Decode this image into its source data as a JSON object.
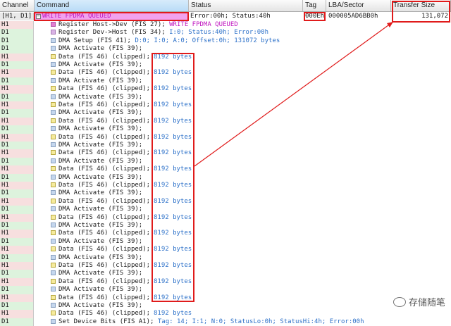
{
  "columns": [
    "Channel",
    "Command",
    "Status",
    "Tag",
    "LBA/Sector",
    "Transfer Size"
  ],
  "first_row": {
    "channel": "[H1, D1]",
    "expander": "⊟",
    "command": "WRITE FPDMA QUEUED",
    "status": "Error:00h; Status:40h",
    "tag": "000Eh",
    "lba": "000005AD6BB0h",
    "size": "131,072"
  },
  "rows": [
    {
      "ch": "H1",
      "icon": "magenta",
      "text": "Register Host->Dev (FIS 27); ",
      "extra": "WRITE FPDMA QUEUED",
      "extra_color": "magenta"
    },
    {
      "ch": "D1",
      "icon": "lilac",
      "text": "Register Dev->Host (FIS 34); ",
      "extra": "I:0; Status:40h; Error:00h",
      "extra_color": "blue"
    },
    {
      "ch": "D1",
      "icon": "blue",
      "text": "DMA Setup (FIS 41); ",
      "extra": "D:0; I:0; A:0; Offset:0h; 131072 bytes",
      "extra_color": "blue"
    },
    {
      "ch": "D1",
      "icon": "blue",
      "text": "DMA Activate (FIS 39);",
      "extra": "",
      "extra_color": "blue"
    },
    {
      "ch": "H1",
      "icon": "yellow",
      "text": "Data (FIS 46) (clipped);",
      "extra": "8192 bytes",
      "extra_color": "blue"
    },
    {
      "ch": "D1",
      "icon": "blue",
      "text": "DMA Activate (FIS 39);",
      "extra": "",
      "extra_color": "blue"
    },
    {
      "ch": "H1",
      "icon": "yellow",
      "text": "Data (FIS 46) (clipped);",
      "extra": "8192 bytes",
      "extra_color": "blue"
    },
    {
      "ch": "D1",
      "icon": "blue",
      "text": "DMA Activate (FIS 39);",
      "extra": "",
      "extra_color": "blue"
    },
    {
      "ch": "H1",
      "icon": "yellow",
      "text": "Data (FIS 46) (clipped);",
      "extra": "8192 bytes",
      "extra_color": "blue"
    },
    {
      "ch": "D1",
      "icon": "blue",
      "text": "DMA Activate (FIS 39);",
      "extra": "",
      "extra_color": "blue"
    },
    {
      "ch": "H1",
      "icon": "yellow",
      "text": "Data (FIS 46) (clipped);",
      "extra": "8192 bytes",
      "extra_color": "blue"
    },
    {
      "ch": "D1",
      "icon": "blue",
      "text": "DMA Activate (FIS 39);",
      "extra": "",
      "extra_color": "blue"
    },
    {
      "ch": "H1",
      "icon": "yellow",
      "text": "Data (FIS 46) (clipped);",
      "extra": "8192 bytes",
      "extra_color": "blue"
    },
    {
      "ch": "D1",
      "icon": "blue",
      "text": "DMA Activate (FIS 39);",
      "extra": "",
      "extra_color": "blue"
    },
    {
      "ch": "H1",
      "icon": "yellow",
      "text": "Data (FIS 46) (clipped);",
      "extra": "8192 bytes",
      "extra_color": "blue"
    },
    {
      "ch": "D1",
      "icon": "blue",
      "text": "DMA Activate (FIS 39);",
      "extra": "",
      "extra_color": "blue"
    },
    {
      "ch": "H1",
      "icon": "yellow",
      "text": "Data (FIS 46) (clipped);",
      "extra": "8192 bytes",
      "extra_color": "blue"
    },
    {
      "ch": "D1",
      "icon": "blue",
      "text": "DMA Activate (FIS 39);",
      "extra": "",
      "extra_color": "blue"
    },
    {
      "ch": "H1",
      "icon": "yellow",
      "text": "Data (FIS 46) (clipped);",
      "extra": "8192 bytes",
      "extra_color": "blue"
    },
    {
      "ch": "D1",
      "icon": "blue",
      "text": "DMA Activate (FIS 39);",
      "extra": "",
      "extra_color": "blue"
    },
    {
      "ch": "H1",
      "icon": "yellow",
      "text": "Data (FIS 46) (clipped);",
      "extra": "8192 bytes",
      "extra_color": "blue"
    },
    {
      "ch": "D1",
      "icon": "blue",
      "text": "DMA Activate (FIS 39);",
      "extra": "",
      "extra_color": "blue"
    },
    {
      "ch": "H1",
      "icon": "yellow",
      "text": "Data (FIS 46) (clipped);",
      "extra": "8192 bytes",
      "extra_color": "blue"
    },
    {
      "ch": "D1",
      "icon": "blue",
      "text": "DMA Activate (FIS 39);",
      "extra": "",
      "extra_color": "blue"
    },
    {
      "ch": "H1",
      "icon": "yellow",
      "text": "Data (FIS 46) (clipped);",
      "extra": "8192 bytes",
      "extra_color": "blue"
    },
    {
      "ch": "D1",
      "icon": "blue",
      "text": "DMA Activate (FIS 39);",
      "extra": "",
      "extra_color": "blue"
    },
    {
      "ch": "H1",
      "icon": "yellow",
      "text": "Data (FIS 46) (clipped);",
      "extra": "8192 bytes",
      "extra_color": "blue"
    },
    {
      "ch": "D1",
      "icon": "blue",
      "text": "DMA Activate (FIS 39);",
      "extra": "",
      "extra_color": "blue"
    },
    {
      "ch": "H1",
      "icon": "yellow",
      "text": "Data (FIS 46) (clipped);",
      "extra": "8192 bytes",
      "extra_color": "blue"
    },
    {
      "ch": "D1",
      "icon": "blue",
      "text": "DMA Activate (FIS 39);",
      "extra": "",
      "extra_color": "blue"
    },
    {
      "ch": "H1",
      "icon": "yellow",
      "text": "Data (FIS 46) (clipped);",
      "extra": "8192 bytes",
      "extra_color": "blue"
    },
    {
      "ch": "D1",
      "icon": "blue",
      "text": "DMA Activate (FIS 39);",
      "extra": "",
      "extra_color": "blue"
    },
    {
      "ch": "H1",
      "icon": "yellow",
      "text": "Data (FIS 46) (clipped);",
      "extra": "8192 bytes",
      "extra_color": "blue"
    },
    {
      "ch": "D1",
      "icon": "blue",
      "text": "DMA Activate (FIS 39);",
      "extra": "",
      "extra_color": "blue"
    },
    {
      "ch": "H1",
      "icon": "yellow",
      "text": "Data (FIS 46) (clipped);",
      "extra": "8192 bytes",
      "extra_color": "blue"
    },
    {
      "ch": "D1",
      "icon": "blue",
      "text": "DMA Activate (FIS 39);",
      "extra": "",
      "extra_color": "blue"
    },
    {
      "ch": "H1",
      "icon": "yellow",
      "text": "Data (FIS 46) (clipped);",
      "extra": "8192 bytes",
      "extra_color": "blue"
    },
    {
      "ch": "D1",
      "icon": "blue",
      "text": "Set Device Bits (FIS A1); ",
      "extra": "Tag: 14; I:1; N:0; StatusLo:0h; StatusHi:4h; Error:00h",
      "extra_color": "blue"
    }
  ],
  "watermark": "存储随笔",
  "watermark_icon": "chat-bubble-icon",
  "colors": {
    "highlight": "#e01b1b",
    "magenta": "#c018c0",
    "blue": "#2d71c9",
    "host_row": "#f7dfdf",
    "device_row": "#ddf3dd"
  }
}
